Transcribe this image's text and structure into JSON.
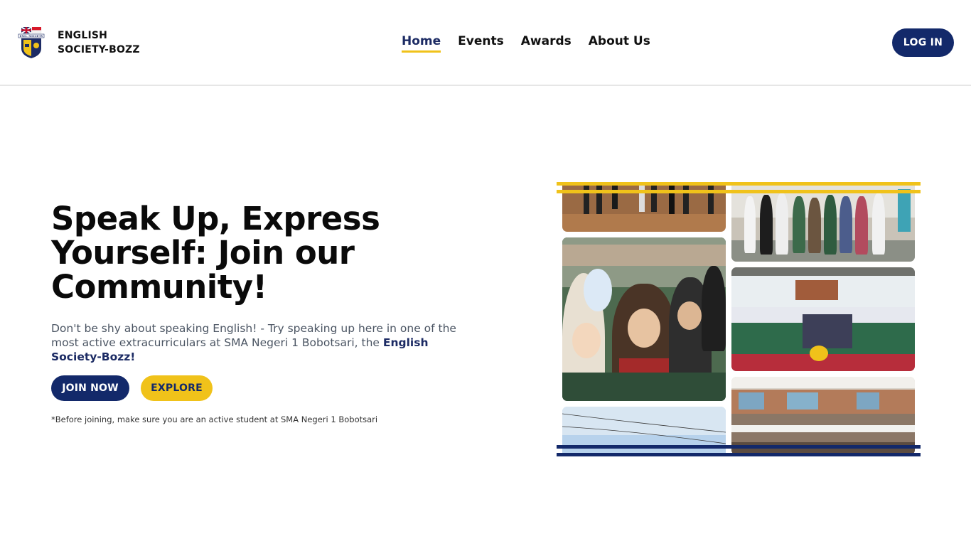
{
  "brand": {
    "name": "ENGLISH SOCIETY-BOZZ",
    "logo_icon": "eng-society-badge-icon",
    "logo_text": "ENG. SOCIETY"
  },
  "nav": {
    "items": [
      {
        "label": "Home",
        "active": true
      },
      {
        "label": "Events",
        "active": false
      },
      {
        "label": "Awards",
        "active": false
      },
      {
        "label": "About Us",
        "active": false
      }
    ]
  },
  "header": {
    "login_label": "LOG IN"
  },
  "hero": {
    "title": "Speak Up, Express Yourself: Join our Community!",
    "description": "Don't be shy about speaking English! - Try speaking up here in one of the most active extracurriculars at SMA Negeri 1 Bobotsari, the ",
    "description_highlight": "English Society-Bozz!",
    "join_label": "JOIN NOW",
    "explore_label": "EXPLORE",
    "note": "*Before joining, make sure you are an active student at SMA Negeri 1 Bobotsari"
  },
  "colors": {
    "navy": "#13296a",
    "accent_yellow": "#f0c21a",
    "text_muted": "#4b5563"
  },
  "gallery": {
    "photos": [
      {
        "name": "photo-group-standing-legs"
      },
      {
        "name": "photo-award-ceremony"
      },
      {
        "name": "photo-students-selfie"
      },
      {
        "name": "photo-group-stage"
      },
      {
        "name": "photo-sky"
      },
      {
        "name": "photo-auditorium"
      }
    ]
  }
}
